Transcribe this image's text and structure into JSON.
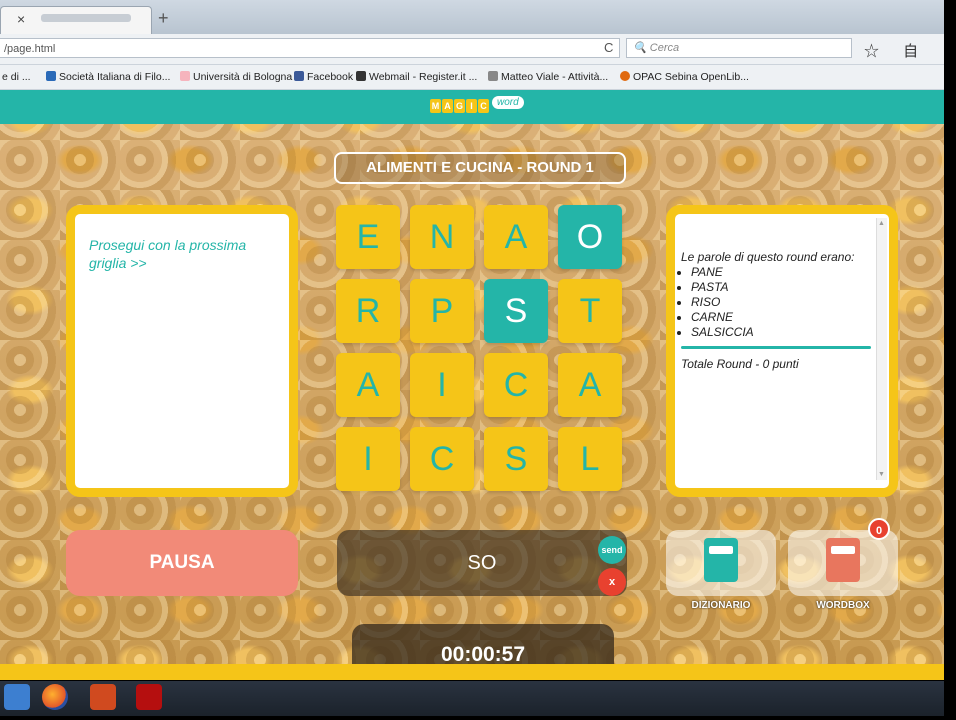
{
  "browser": {
    "tab_close": "×",
    "new_tab": "+",
    "url": "/page.html",
    "reload": "C",
    "search_placeholder": "Cerca",
    "nav_icons": "☆ 自 ▽",
    "bookmarks": [
      {
        "label": "e di ...",
        "color": "#ffffff"
      },
      {
        "label": "Società Italiana di Filo...",
        "color": "#2a6ab8"
      },
      {
        "label": "Università di Bologna",
        "color": "#f6b4bd"
      },
      {
        "label": "Facebook",
        "color": "#3b5998"
      },
      {
        "label": "Webmail - Register.it ...",
        "color": "#333333"
      },
      {
        "label": "Matteo Viale - Attività...",
        "color": "#888888"
      },
      {
        "label": "OPAC Sebina OpenLib...",
        "color": "#e06a10"
      }
    ]
  },
  "app": {
    "logo_letters": [
      "M",
      "A",
      "G",
      "I",
      "C"
    ],
    "logo_word": "word",
    "round_title": "ALIMENTI E CUCINA - ROUND 1",
    "left_panel_text": "Prosegui con la prossima griglia >>",
    "right_panel": {
      "intro": "Le parole di questo round erano:",
      "words": [
        "PANE",
        "PASTA",
        "RISO",
        "CARNE",
        "SALSICCIA"
      ],
      "total": "Totale Round - 0 punti"
    },
    "grid": [
      [
        "E",
        "N",
        "A",
        "O"
      ],
      [
        "R",
        "P",
        "S",
        "T"
      ],
      [
        "A",
        "I",
        "C",
        "A"
      ],
      [
        "I",
        "C",
        "S",
        "L"
      ]
    ],
    "selected_cells": [
      "0-3",
      "1-2"
    ],
    "pause_label": "PAUSA",
    "current_word": "SO",
    "send_label": "send",
    "cancel_label": "x",
    "dictionary_label": "DIZIONARIO",
    "wordbox_label": "WORDBOX",
    "wordbox_count": "0",
    "timer": "00:00:57",
    "colors": {
      "teal": "#24b5a8",
      "yellow": "#f5c518",
      "pause": "#f28a78",
      "red": "#e8412f"
    }
  },
  "taskbar": {
    "buttons": [
      "start-icon",
      "firefox-icon",
      "powerpoint-icon",
      "acrobat-icon"
    ]
  }
}
